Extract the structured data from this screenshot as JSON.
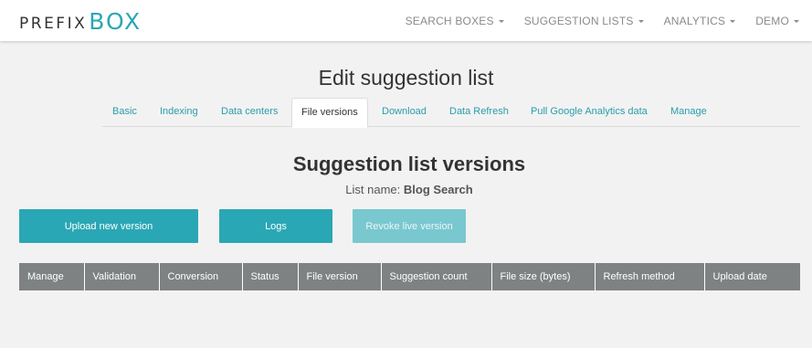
{
  "navbar": {
    "logo_prefix": "PREFIX",
    "logo_box": "BOX",
    "menu": [
      {
        "label": "SEARCH BOXES"
      },
      {
        "label": "SUGGESTION LISTS"
      },
      {
        "label": "ANALYTICS"
      },
      {
        "label": "DEMO"
      }
    ]
  },
  "page": {
    "title": "Edit suggestion list"
  },
  "tabs": [
    {
      "label": "Basic"
    },
    {
      "label": "Indexing"
    },
    {
      "label": "Data centers"
    },
    {
      "label": "File versions",
      "active": true
    },
    {
      "label": "Download"
    },
    {
      "label": "Data Refresh"
    },
    {
      "label": "Pull Google Analytics data"
    },
    {
      "label": "Manage"
    }
  ],
  "section": {
    "title": "Suggestion list versions",
    "list_name_label": "List name:",
    "list_name_value": "Blog Search"
  },
  "buttons": {
    "upload": "Upload new version",
    "logs": "Logs",
    "revoke": "Revoke live version"
  },
  "table": {
    "headers": [
      "Manage",
      "Validation",
      "Conversion",
      "Status",
      "File version",
      "Suggestion count",
      "File size (bytes)",
      "Refresh method",
      "Upload date"
    ]
  },
  "colors": {
    "accent": "#2aa7b4",
    "accent_disabled": "#79c8cf",
    "table_header": "#7f8283",
    "background": "#f2f2f2"
  }
}
